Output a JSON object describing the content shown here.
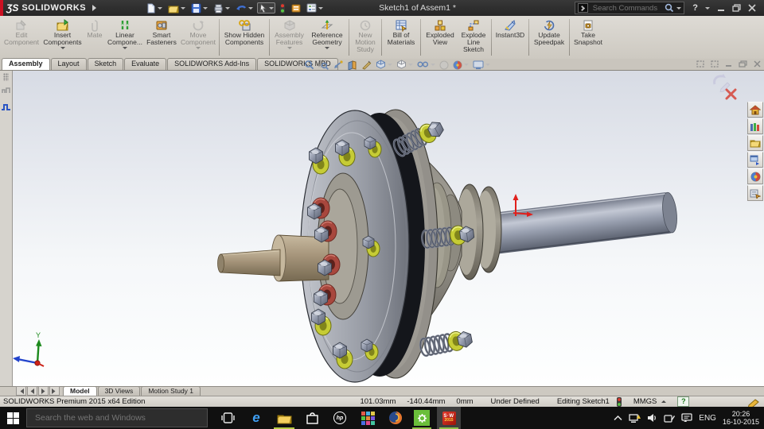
{
  "titlebar": {
    "logo_mark": "ƷS",
    "logo_text": "SOLIDWORKS",
    "doc_title": "Sketch1 of Assem1 *",
    "search_placeholder": "Search Commands",
    "help_glyph": "?"
  },
  "ribbon": {
    "buttons": [
      {
        "label": "Edit Component",
        "enabled": false,
        "dropdown": false
      },
      {
        "label": "Insert Components",
        "enabled": true,
        "dropdown": true
      },
      {
        "label": "Mate",
        "enabled": false,
        "dropdown": false
      },
      {
        "label": "Linear Compone...",
        "enabled": true,
        "dropdown": true
      },
      {
        "label": "Smart Fasteners",
        "enabled": true,
        "dropdown": false
      },
      {
        "label": "Move Component",
        "enabled": false,
        "dropdown": true
      },
      {
        "label": "Show Hidden Components",
        "enabled": true,
        "dropdown": false
      },
      {
        "label": "Assembly Features",
        "enabled": false,
        "dropdown": true
      },
      {
        "label": "Reference Geometry",
        "enabled": true,
        "dropdown": true
      },
      {
        "label": "New Motion Study",
        "enabled": false,
        "dropdown": false
      },
      {
        "label": "Bill of Materials",
        "enabled": true,
        "dropdown": false
      },
      {
        "label": "Exploded View",
        "enabled": true,
        "dropdown": false
      },
      {
        "label": "Explode Line Sketch",
        "enabled": true,
        "dropdown": false
      },
      {
        "label": "Instant3D",
        "enabled": true,
        "dropdown": false
      },
      {
        "label": "Update Speedpak",
        "enabled": true,
        "dropdown": false
      },
      {
        "label": "Take Snapshot",
        "enabled": true,
        "dropdown": false
      }
    ]
  },
  "tabs": {
    "items": [
      {
        "label": "Assembly",
        "active": true
      },
      {
        "label": "Layout",
        "active": false
      },
      {
        "label": "Sketch",
        "active": false
      },
      {
        "label": "Evaluate",
        "active": false
      },
      {
        "label": "SOLIDWORKS Add-Ins",
        "active": false
      },
      {
        "label": "SOLIDWORKS MBD",
        "active": false
      }
    ]
  },
  "viewport": {
    "triad_y": "Y"
  },
  "doc_tabs": {
    "items": [
      {
        "label": "Model",
        "active": true
      },
      {
        "label": "3D Views",
        "active": false
      },
      {
        "label": "Motion Study 1",
        "active": false
      }
    ]
  },
  "statusbar": {
    "product": "SOLIDWORKS Premium 2015 x64 Edition",
    "x_coord": "101.03mm",
    "y_coord": "-140.44mm",
    "z_coord": "0mm",
    "definition": "Under Defined",
    "mode": "Editing Sketch1",
    "units": "MMGS",
    "help_glyph": "?"
  },
  "taskbar": {
    "search_placeholder": "Search the web and Windows",
    "edge_glyph": "e",
    "hp_glyph": "hp",
    "sw_glyph": "S·W",
    "sw_year": "2015",
    "lang": "ENG",
    "time": "20:26",
    "date": "16-10-2015"
  },
  "colors": {
    "brand_red": "#cb1122",
    "washer_yellow": "#c6cc35",
    "bush_red": "#a8473d",
    "titlebar_bg": "#2b2b2b",
    "taskbar_bg": "#101010",
    "viewport_top": "#d7dbe4"
  }
}
